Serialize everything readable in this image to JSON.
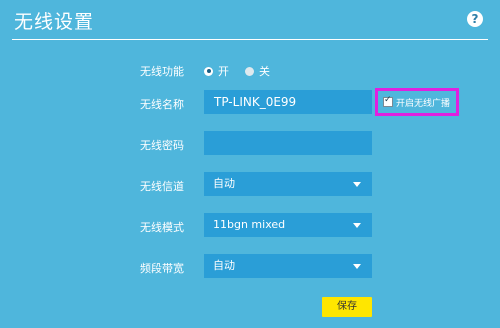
{
  "page": {
    "title": "无线设置",
    "help_glyph": "?"
  },
  "wireless_function": {
    "label": "无线功能",
    "options": [
      {
        "label": "开",
        "checked": true
      },
      {
        "label": "关",
        "checked": false
      }
    ]
  },
  "ssid": {
    "label": "无线名称",
    "value": "TP-LINK_0E99"
  },
  "broadcast": {
    "label": "开启无线广播",
    "checked": true,
    "highlight_color": "#e020e0"
  },
  "password": {
    "label": "无线密码",
    "value": ""
  },
  "channel": {
    "label": "无线信道",
    "value": "自动"
  },
  "mode": {
    "label": "无线模式",
    "value": "11bgn mixed"
  },
  "bandwidth": {
    "label": "频段带宽",
    "value": "自动"
  },
  "actions": {
    "save_label": "保存"
  },
  "colors": {
    "background": "#4fb6dc",
    "field": "#2a9ed7",
    "save_button": "#ffe600"
  }
}
